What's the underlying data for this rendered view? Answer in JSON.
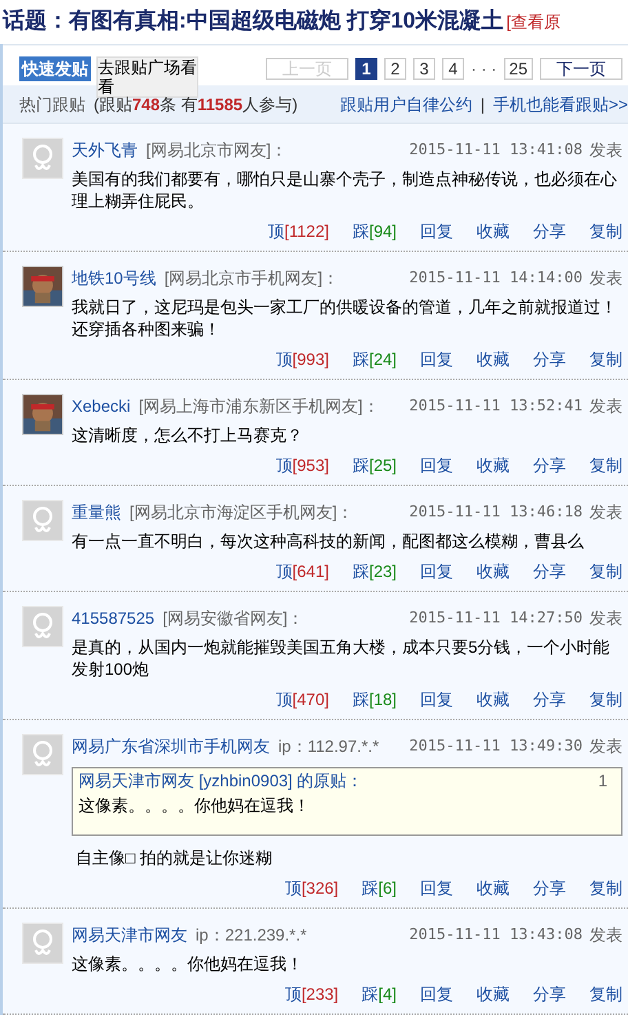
{
  "title": {
    "label": "话题：",
    "text": "有图有真相:中国超级电磁炮 打穿10米混凝土",
    "link": "[查看原"
  },
  "toolbar": {
    "post_button": "快速发贴",
    "square_button": "去跟贴广场看看"
  },
  "pagination": [
    {
      "kind": "prev",
      "label": "上一页",
      "disabled": true
    },
    {
      "kind": "page",
      "label": "1",
      "selected": true
    },
    {
      "kind": "page",
      "label": "2",
      "selected": false
    },
    {
      "kind": "page",
      "label": "3",
      "selected": false
    },
    {
      "kind": "page",
      "label": "4",
      "selected": false
    },
    {
      "kind": "ellipsis",
      "label": "· · ·"
    },
    {
      "kind": "page",
      "label": "25",
      "selected": false
    },
    {
      "kind": "next",
      "label": "下一页",
      "disabled": false
    }
  ],
  "stats": {
    "label": "热门跟贴",
    "prefix": "(跟贴",
    "posts": "748",
    "mid": "条 有",
    "users": "11585",
    "suffix": "人参与)",
    "links": [
      "跟贴用户自律公约",
      "手机也能看跟贴>>"
    ],
    "separator": "|"
  },
  "posts": [
    {
      "avatar": {
        "kind": "default"
      },
      "name": "天外飞青",
      "origin": "[网易北京市网友]：",
      "date": "2015-11-11 13:41:08",
      "posted": "发表",
      "content": "美国有的我们都要有，哪怕只是山寨个壳子，制造点神秘传说，也必须在心理上糊弄住屁民。",
      "votes": [
        {
          "kind": "up",
          "label": "顶",
          "count": "[1122]"
        },
        {
          "kind": "down",
          "label": "踩",
          "count": "[94]"
        }
      ],
      "actions": [
        "回复",
        "收藏",
        "分享",
        "复制"
      ]
    },
    {
      "name": "地铁10号线",
      "origin": "[网易北京市手机网友]：",
      "date": "2015-11-11 14:14:00",
      "posted": "发表",
      "content": "我就日了，这尼玛是包头一家工厂的供暖设备的管道，几年之前就报道过！还穿插各种图来骗！",
      "votes": [
        {
          "kind": "up",
          "label": "顶",
          "count": "[993]"
        },
        {
          "kind": "down",
          "label": "踩",
          "count": "[24]"
        }
      ],
      "actions": [
        "回复",
        "收藏",
        "分享",
        "复制"
      ]
    },
    {
      "name": "Xebecki",
      "origin": "[网易上海市浦东新区手机网友]：",
      "date": "2015-11-11 13:52:41",
      "posted": "发表",
      "content": "这清晰度，怎么不打上马赛克？",
      "votes": [
        {
          "kind": "up",
          "label": "顶",
          "count": "[953]"
        },
        {
          "kind": "down",
          "label": "踩",
          "count": "[25]"
        }
      ],
      "actions": [
        "回复",
        "收藏",
        "分享",
        "复制"
      ]
    },
    {
      "avatar": {
        "kind": "default"
      },
      "name": "重量熊",
      "origin": "[网易北京市海淀区手机网友]：",
      "date": "2015-11-11 13:46:18",
      "posted": "发表",
      "content": "有一点一直不明白，每次这种高科技的新闻，配图都这么模糊，曹县么",
      "votes": [
        {
          "kind": "up",
          "label": "顶",
          "count": "[641]"
        },
        {
          "kind": "down",
          "label": "踩",
          "count": "[23]"
        }
      ],
      "actions": [
        "回复",
        "收藏",
        "分享",
        "复制"
      ]
    },
    {
      "avatar": {
        "kind": "default"
      },
      "name": "415587525",
      "origin": "[网易安徽省网友]：",
      "date": "2015-11-11 14:27:50",
      "posted": "发表",
      "content": "是真的，从国内一炮就能摧毁美国五角大楼，成本只要5分钱，一个小时能发射100炮",
      "votes": [
        {
          "kind": "up",
          "label": "顶",
          "count": "[470]"
        },
        {
          "kind": "down",
          "label": "踩",
          "count": "[18]"
        }
      ],
      "actions": [
        "回复",
        "收藏",
        "分享",
        "复制"
      ]
    },
    {
      "avatar": {
        "kind": "default"
      },
      "name": "网易广东省深圳市手机网友",
      "origin": "ip：112.97.*.*",
      "date": "2015-11-11 13:49:30",
      "posted": "发表",
      "quote": {
        "author": "网易天津市网友 [yzhbin0903] 的原贴：",
        "floor": "1",
        "content": "这像素。。。。你他妈在逗我！"
      },
      "content": "自主像□ 拍的就是让你迷糊",
      "votes": [
        {
          "kind": "up",
          "label": "顶",
          "count": "[326]"
        },
        {
          "kind": "down",
          "label": "踩",
          "count": "[6]"
        }
      ],
      "actions": [
        "回复",
        "收藏",
        "分享",
        "复制"
      ]
    },
    {
      "avatar": {
        "kind": "default"
      },
      "name": "网易天津市网友",
      "origin": "ip：221.239.*.*",
      "date": "2015-11-11 13:43:08",
      "posted": "发表",
      "content": "这像素。。。。你他妈在逗我！",
      "votes": [
        {
          "kind": "up",
          "label": "顶",
          "count": "[233]"
        },
        {
          "kind": "down",
          "label": "踩",
          "count": "[4]"
        }
      ],
      "actions": [
        "回复",
        "收藏",
        "分享",
        "复制"
      ]
    }
  ]
}
